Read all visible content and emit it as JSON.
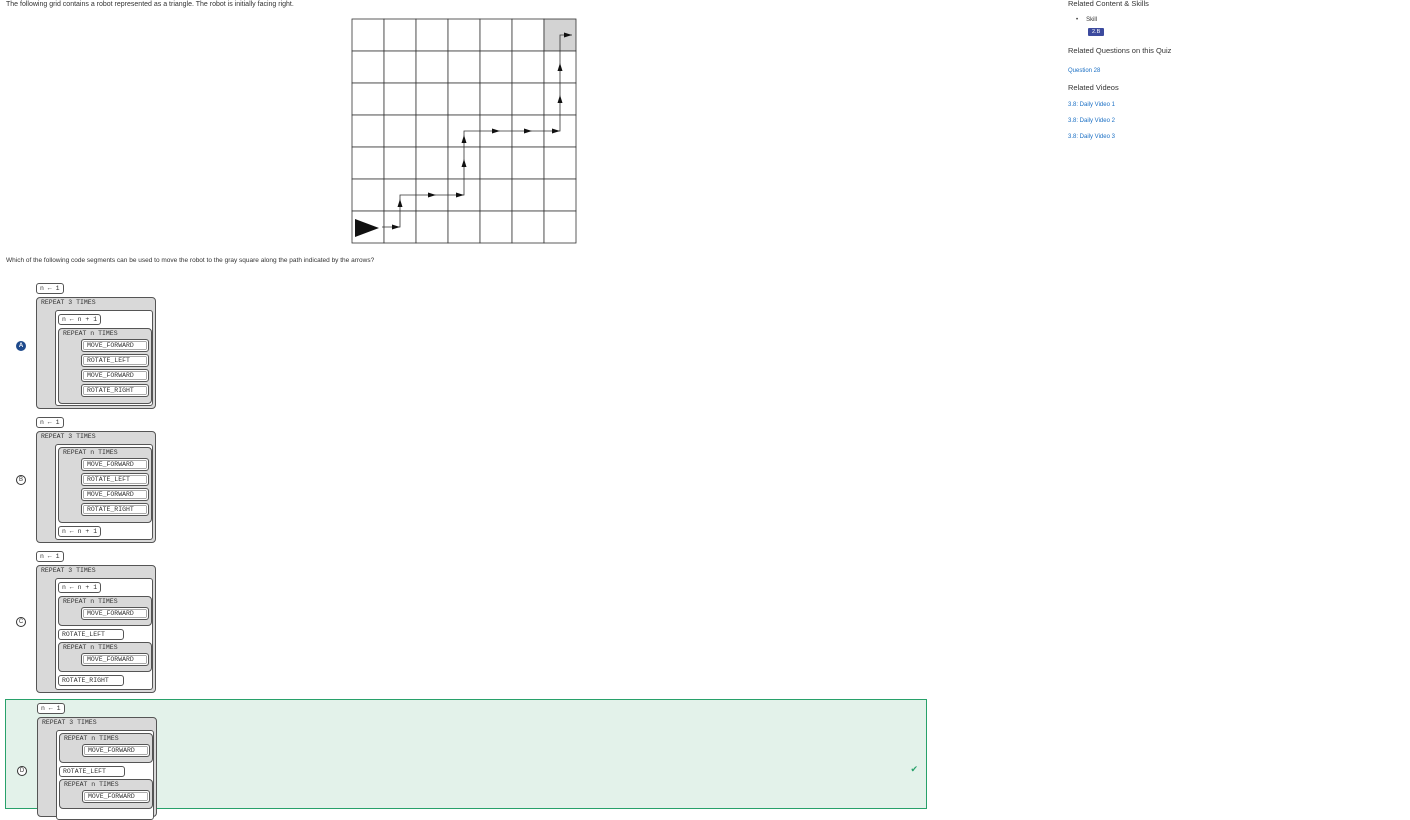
{
  "question": {
    "prompt": "The following grid contains a robot represented as a triangle. The robot is initially facing right.",
    "text": "Which of the following code segments can be used to move the robot to the gray square along the path indicated by the arrows?"
  },
  "options": [
    {
      "letter": "A",
      "selected": true,
      "correct": false,
      "init": "n ← 1",
      "repeat_outer": "REPEAT 3 TIMES",
      "increment": "n ← n + 1",
      "repeat_n": "REPEAT n TIMES",
      "commands": [
        "MOVE_FORWARD",
        "ROTATE_LEFT",
        "MOVE_FORWARD",
        "ROTATE_RIGHT"
      ]
    },
    {
      "letter": "B",
      "selected": false,
      "correct": false,
      "init": "n ← 1",
      "repeat_outer": "REPEAT 3 TIMES",
      "increment": "n ← n + 1",
      "repeat_n": "REPEAT n TIMES",
      "commands": [
        "MOVE_FORWARD",
        "ROTATE_LEFT",
        "MOVE_FORWARD",
        "ROTATE_RIGHT"
      ]
    },
    {
      "letter": "C",
      "selected": false,
      "correct": false,
      "init": "n ← 1",
      "repeat_outer": "REPEAT 3 TIMES",
      "increment": "n ← n + 1",
      "repeat_n": "REPEAT n TIMES",
      "move": "MOVE_FORWARD",
      "rotate_left": "ROTATE_LEFT",
      "rotate_right": "ROTATE_RIGHT"
    },
    {
      "letter": "D",
      "selected": false,
      "correct": true,
      "init": "n ← 1",
      "repeat_outer": "REPEAT 3 TIMES",
      "repeat_n": "REPEAT n TIMES",
      "move": "MOVE_FORWARD",
      "rotate_left": "ROTATE_LEFT"
    }
  ],
  "sidebar": {
    "related_heading": "Related Content & Skills",
    "skill_label": "Skill",
    "skill_badge": "2.B",
    "related_questions_heading": "Related Questions on this Quiz",
    "question_link": "Question 28",
    "related_videos_heading": "Related Videos",
    "videos": [
      "3.8: Daily Video 1",
      "3.8: Daily Video 2",
      "3.8: Daily Video 3"
    ]
  },
  "icons": {
    "selected": "filled-radio",
    "correct": "checkmark-icon"
  },
  "colors": {
    "accent": "#1e4a8c",
    "correct_bg": "#e3f2ea",
    "correct_border": "#28a16a",
    "link": "#1a6fc4",
    "badge": "#3c4a9e"
  }
}
